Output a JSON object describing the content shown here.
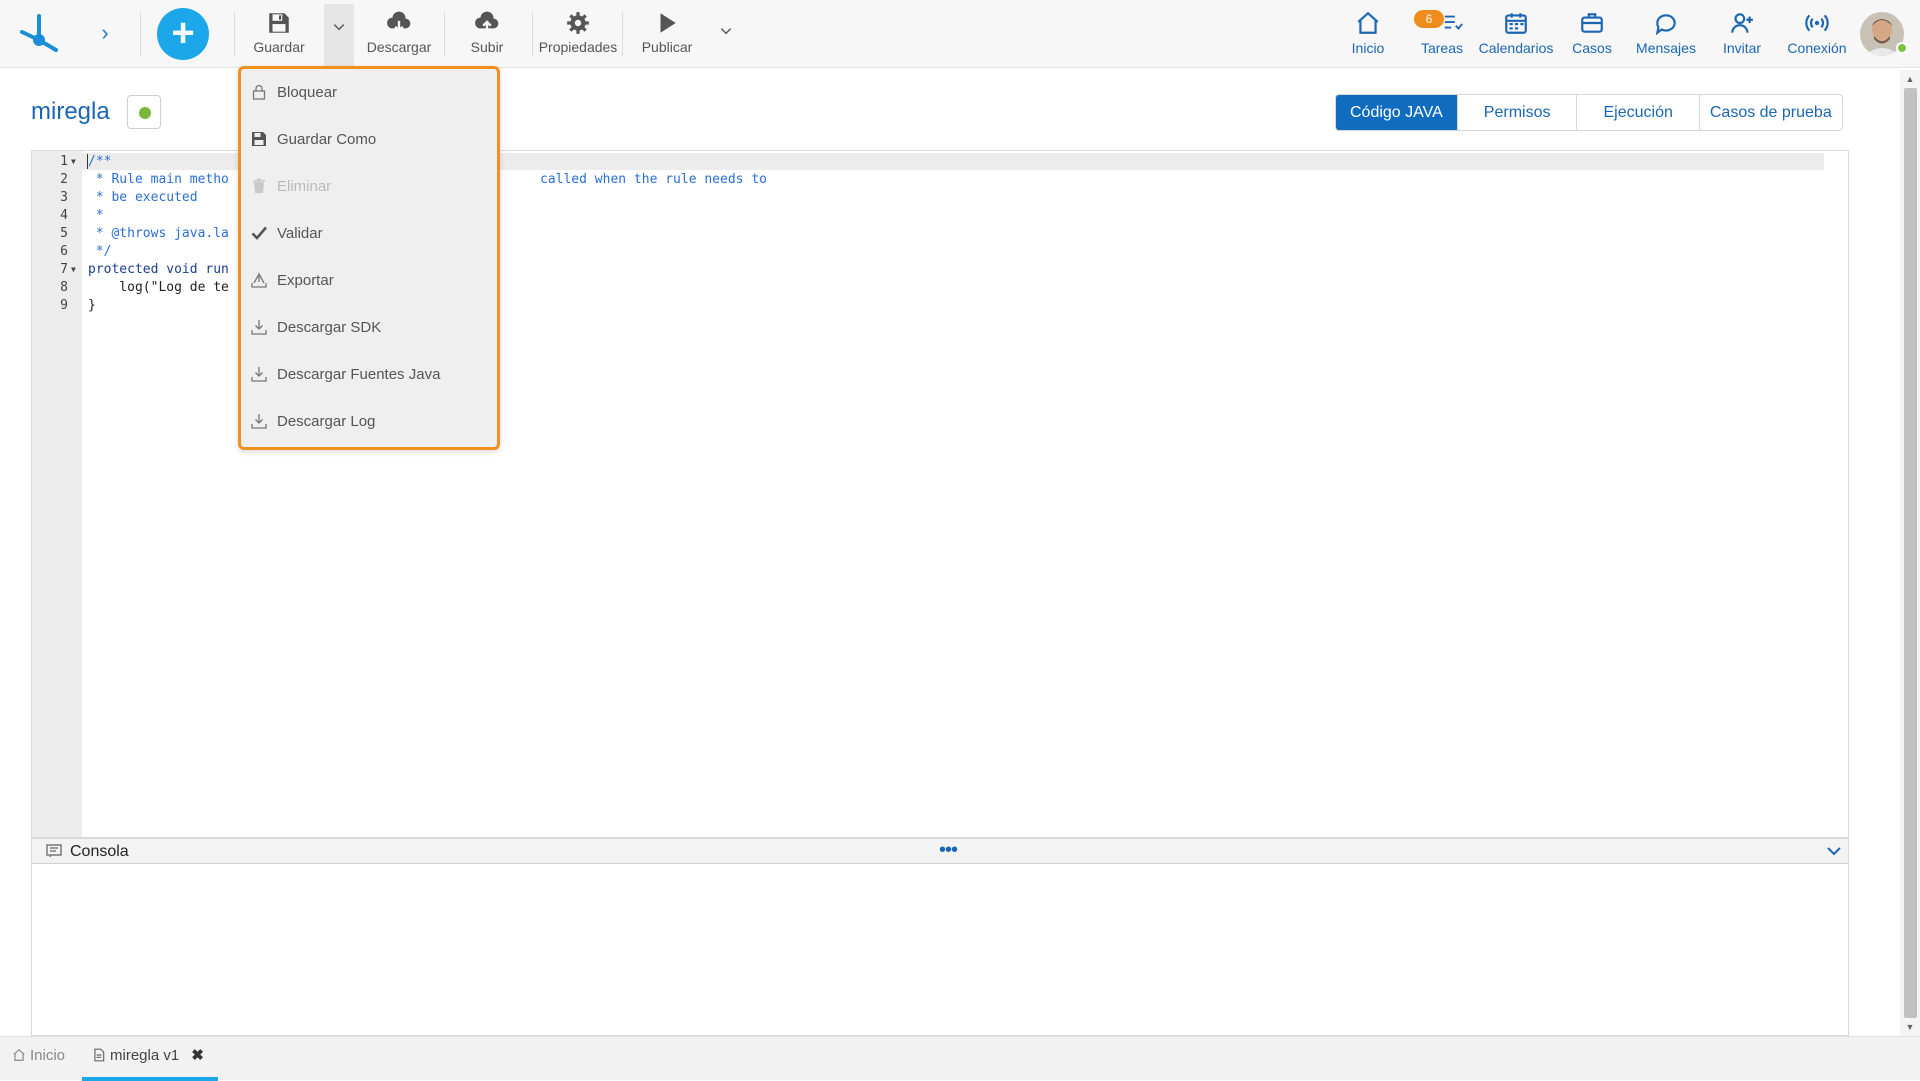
{
  "toolbar": {
    "guardar": "Guardar",
    "descargar": "Descargar",
    "subir": "Subir",
    "propiedades": "Propiedades",
    "publicar": "Publicar"
  },
  "nav": {
    "inicio": "Inicio",
    "tareas": "Tareas",
    "tareas_badge": "6",
    "calendarios": "Calendarios",
    "casos": "Casos",
    "mensajes": "Mensajes",
    "invitar": "Invitar",
    "conexion": "Conexión"
  },
  "page": {
    "title": "miregla"
  },
  "tabs": [
    "Código JAVA",
    "Permisos",
    "Ejecución",
    "Casos de prueba"
  ],
  "code": {
    "lines": [
      {
        "n": "1",
        "text": "/**"
      },
      {
        "n": "2",
        "text": " * Rule main metho"
      },
      {
        "n": "3",
        "text": " * be executed"
      },
      {
        "n": "4",
        "text": " *"
      },
      {
        "n": "5",
        "text": " * @throws java.la"
      },
      {
        "n": "6",
        "text": " */"
      },
      {
        "n": "7",
        "text": "protected void run"
      },
      {
        "n": "8",
        "text": "    log(\"Log de te"
      },
      {
        "n": "9",
        "text": "}"
      }
    ],
    "line2_tail": "called when the rule needs to"
  },
  "console": {
    "label": "Consola",
    "dots": "•••"
  },
  "menu": {
    "items": [
      {
        "label": "Bloquear",
        "icon": "lock-icon",
        "disabled": false
      },
      {
        "label": "Guardar Como",
        "icon": "save-as-icon",
        "disabled": false
      },
      {
        "label": "Eliminar",
        "icon": "trash-icon",
        "disabled": true
      },
      {
        "label": "Validar",
        "icon": "check-icon",
        "disabled": false
      },
      {
        "label": "Exportar",
        "icon": "export-icon",
        "disabled": false
      },
      {
        "label": "Descargar SDK",
        "icon": "download-icon",
        "disabled": false
      },
      {
        "label": "Descargar Fuentes Java",
        "icon": "download-icon",
        "disabled": false
      },
      {
        "label": "Descargar Log",
        "icon": "download-icon",
        "disabled": false
      }
    ]
  },
  "bottom_tabs": {
    "inicio": "Inicio",
    "miregla": "miregla v1",
    "close": "✖"
  },
  "colors": {
    "accent": "#1ba7ea",
    "primary": "#0f6cbf",
    "menu_border": "#f0901e",
    "badge": "#f08c1b",
    "status_ok": "#7ab83d"
  }
}
